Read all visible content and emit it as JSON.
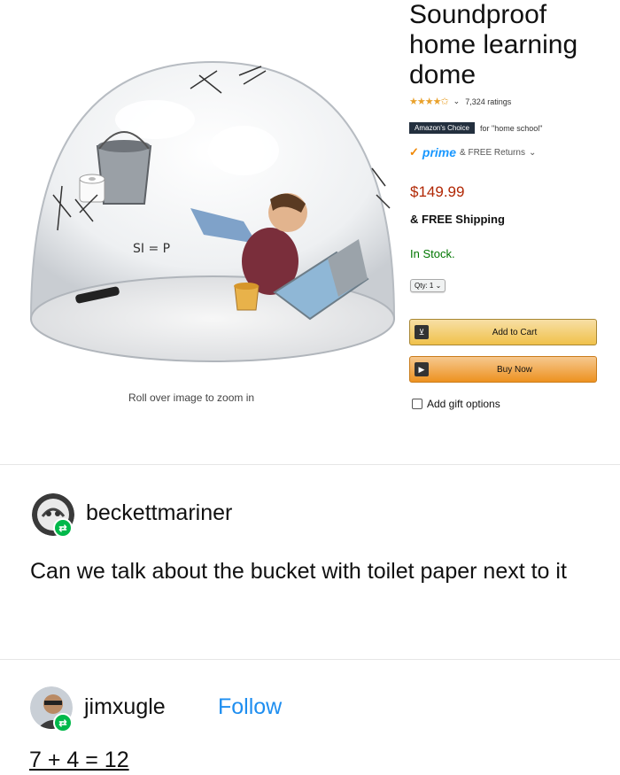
{
  "product": {
    "title": "Soundproof home learning dome",
    "stars": "★★★★✩",
    "ratings": "7,324 ratings",
    "choice_badge": "Amazon's Choice",
    "choice_for": "for \"home school\"",
    "prime": "prime",
    "returns": "& FREE Returns",
    "price": "$149.99",
    "shipping": "& FREE Shipping",
    "stock": "In Stock.",
    "qty": "Qty: 1",
    "add_to_cart": "Add to Cart",
    "buy_now": "Buy Now",
    "gift": "Add gift options",
    "zoom_hint": "Roll over image to zoom in",
    "dome_scribble": "SI = P"
  },
  "comments": [
    {
      "username": "beckettmariner",
      "text": "Can we talk about the bucket with toilet paper next to it"
    },
    {
      "username": "jimxugle",
      "follow": "Follow",
      "text": "7 + 4 = 12"
    }
  ],
  "colors": {
    "price": "#b12704",
    "in_stock": "#007600",
    "follow": "#1e8ef0",
    "reblog_badge": "#00b84a"
  }
}
